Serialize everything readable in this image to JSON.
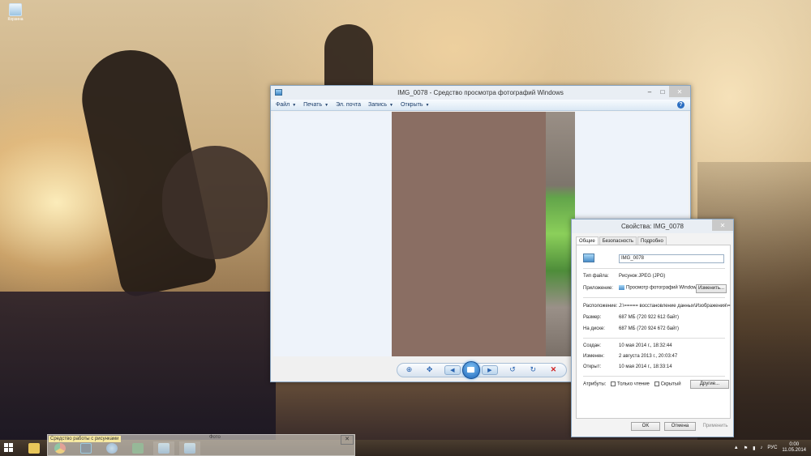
{
  "desktop": {
    "recycle_label": "Корзина"
  },
  "viewer": {
    "title": "IMG_0078 - Средство просмотра фотографий Windows",
    "menu": [
      {
        "label": "Файл"
      },
      {
        "label": "Печать"
      },
      {
        "label": "Эл. почта"
      },
      {
        "label": "Запись"
      },
      {
        "label": "Открыть"
      }
    ],
    "controls": {
      "zoom": "⊕",
      "fit": "✥",
      "prev": "◀",
      "next": "▶",
      "rotate_ccw": "↺",
      "rotate_cw": "↻",
      "delete": "✕"
    }
  },
  "props": {
    "title": "Свойства: IMG_0078",
    "tabs": [
      "Общие",
      "Безопасность",
      "Подробно"
    ],
    "file_name": "IMG_0078",
    "fields": {
      "type_label": "Тип файла:",
      "type_value": "Рисунок JPEG (JPG)",
      "app_label": "Приложение:",
      "app_value": "Просмотр фотографий Windows",
      "change_button": "Изменить...",
      "location_label": "Расположение:",
      "location_value": "J:\\===== восстановление данных\\Изображения\\=",
      "size_label": "Размер:",
      "size_value": "687 МБ (720 922 612 байт)",
      "disk_label": "На диске:",
      "disk_value": "687 МБ (720 924 672 байт)",
      "created_label": "Создан:",
      "created_value": "10 мая 2014 г., 18:32:44",
      "modified_label": "Изменен:",
      "modified_value": "2 августа 2013 г., 20:03:47",
      "opened_label": "Открыт:",
      "opened_value": "10 мая 2014 г., 18:33:14",
      "attrs_label": "Атрибуты:",
      "readonly_label": "Только чтение",
      "hidden_label": "Скрытый",
      "other_button": "Другие..."
    },
    "buttons": {
      "ok": "OK",
      "cancel": "Отмена",
      "apply": "Применить"
    }
  },
  "taskbar": {
    "tooltip": "Средство работы с рисунками",
    "thumb_title": "Фото",
    "lang": "РУС",
    "time": "0:00",
    "date": "11.05.2014"
  }
}
